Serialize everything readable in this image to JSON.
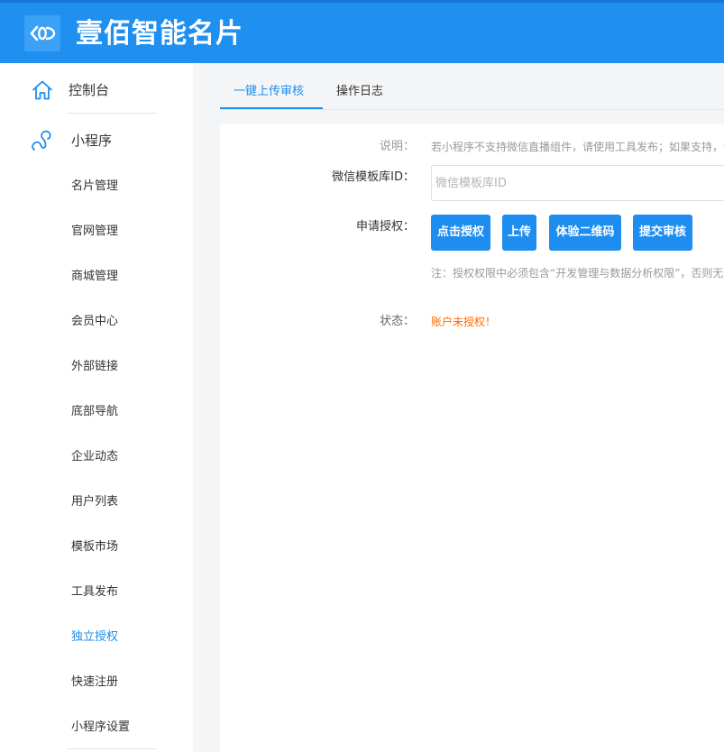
{
  "header": {
    "brand_name": "壹佰智能名片",
    "logo_icon": "infinity-logo-icon",
    "colors": {
      "bar": "#1f8ff0",
      "accent": "#1e8df0"
    }
  },
  "sidebar": {
    "dashboard": {
      "label": "控制台",
      "icon": "home-icon"
    },
    "miniprogram": {
      "label": "小程序",
      "icon": "link-icon"
    },
    "items": [
      {
        "label": "名片管理"
      },
      {
        "label": "官网管理"
      },
      {
        "label": "商城管理"
      },
      {
        "label": "会员中心"
      },
      {
        "label": "外部链接"
      },
      {
        "label": "底部导航"
      },
      {
        "label": "企业动态"
      },
      {
        "label": "用户列表"
      },
      {
        "label": "模板市场"
      },
      {
        "label": "工具发布"
      },
      {
        "label": "独立授权",
        "active": true
      },
      {
        "label": "快速注册"
      },
      {
        "label": "小程序设置"
      }
    ]
  },
  "tabs": [
    {
      "label": "一键上传审核",
      "active": true
    },
    {
      "label": "操作日志"
    }
  ],
  "form": {
    "description": {
      "label": "说明：",
      "text": "若小程序不支持微信直播组件，请使用工具发布；如果支持，请"
    },
    "template_id": {
      "label": "微信模板库ID：",
      "placeholder": "微信模板库ID",
      "value": ""
    },
    "authorize": {
      "label": "申请授权：",
      "buttons": {
        "authorize": "点击授权",
        "upload": "上传",
        "qrcode": "体验二维码",
        "submit": "提交审核"
      },
      "note": "注：授权权限中必须包含“开发管理与数据分析权限”，否则无法"
    },
    "status": {
      "label": "状态：",
      "value": "账户未授权！",
      "color": "#ff6a00"
    }
  }
}
